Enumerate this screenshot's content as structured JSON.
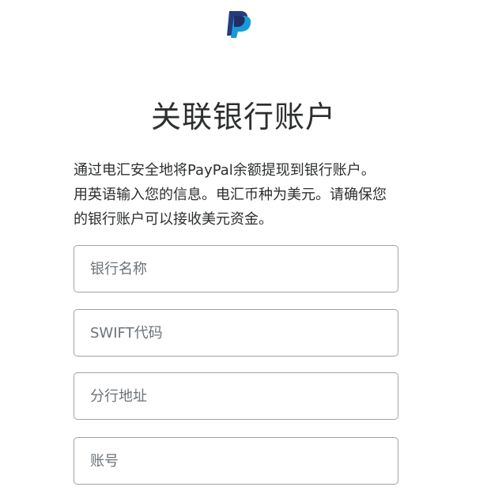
{
  "header": {
    "logo": "paypal-logo"
  },
  "title": "关联银行账户",
  "description": {
    "line1": "通过电汇安全地将PayPal余额提现到银行账户。",
    "line2": "用英语输入您的信息。电汇币种为美元。请确保您",
    "line3": "的银行账户可以接收美元资金。"
  },
  "form": {
    "bank_name": {
      "placeholder": "银行名称",
      "value": ""
    },
    "swift_code": {
      "placeholder": "SWIFT代码",
      "value": ""
    },
    "branch_address": {
      "placeholder": "分行地址",
      "value": ""
    },
    "account_number": {
      "placeholder": "账号",
      "value": ""
    }
  },
  "colors": {
    "logo_dark": "#253b80",
    "logo_light": "#179bd7",
    "text": "#2c2e2f",
    "border": "#9da3a6",
    "placeholder": "#6c7378"
  }
}
